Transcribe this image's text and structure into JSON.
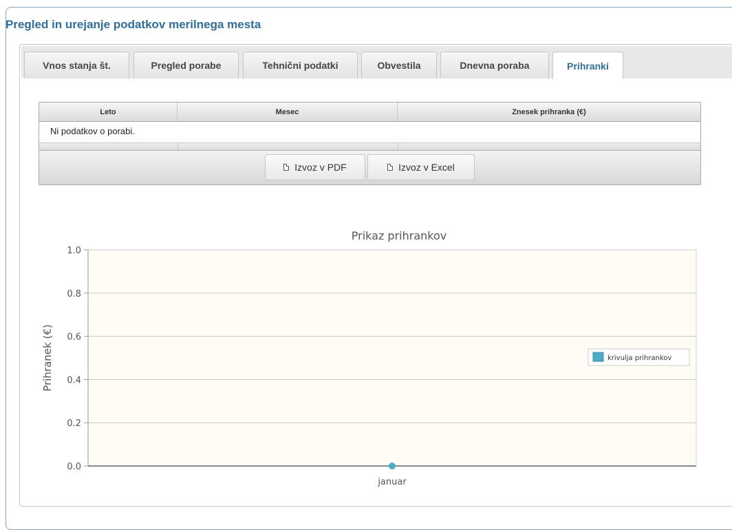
{
  "panel": {
    "title": "Pregled in urejanje podatkov merilnega mesta"
  },
  "tabs": [
    {
      "label": "Vnos stanja št.",
      "active": false
    },
    {
      "label": "Pregled porabe",
      "active": false
    },
    {
      "label": "Tehnični podatki",
      "active": false
    },
    {
      "label": "Obvestila",
      "active": false
    },
    {
      "label": "Dnevna poraba",
      "active": false
    },
    {
      "label": "Prihranki",
      "active": true
    }
  ],
  "grid": {
    "columns": [
      "Leto",
      "Mesec",
      "Znesek prihranka (€)"
    ],
    "empty_message": "Ni podatkov o porabi.",
    "buttons": {
      "pdf": {
        "label": "Izvoz v PDF",
        "icon": "document-icon"
      },
      "excel": {
        "label": "Izvoz v Excel",
        "icon": "document-icon"
      }
    }
  },
  "chart_data": {
    "type": "line",
    "title": "Prikaz prihrankov",
    "xlabel": "",
    "ylabel": "Prihranek (€)",
    "categories": [
      "januar"
    ],
    "series": [
      {
        "name": "krivulja prihrankov",
        "values": [
          0
        ],
        "color": "#4bacc6"
      }
    ],
    "ylim": [
      0,
      1
    ],
    "yticks": [
      "0.0",
      "0.2",
      "0.4",
      "0.6",
      "0.8",
      "1.0"
    ],
    "grid": true,
    "legend": "right",
    "plot_background": "#fefcf4"
  },
  "colors": {
    "title": "#2e6e9e",
    "series": "#4bacc6"
  }
}
